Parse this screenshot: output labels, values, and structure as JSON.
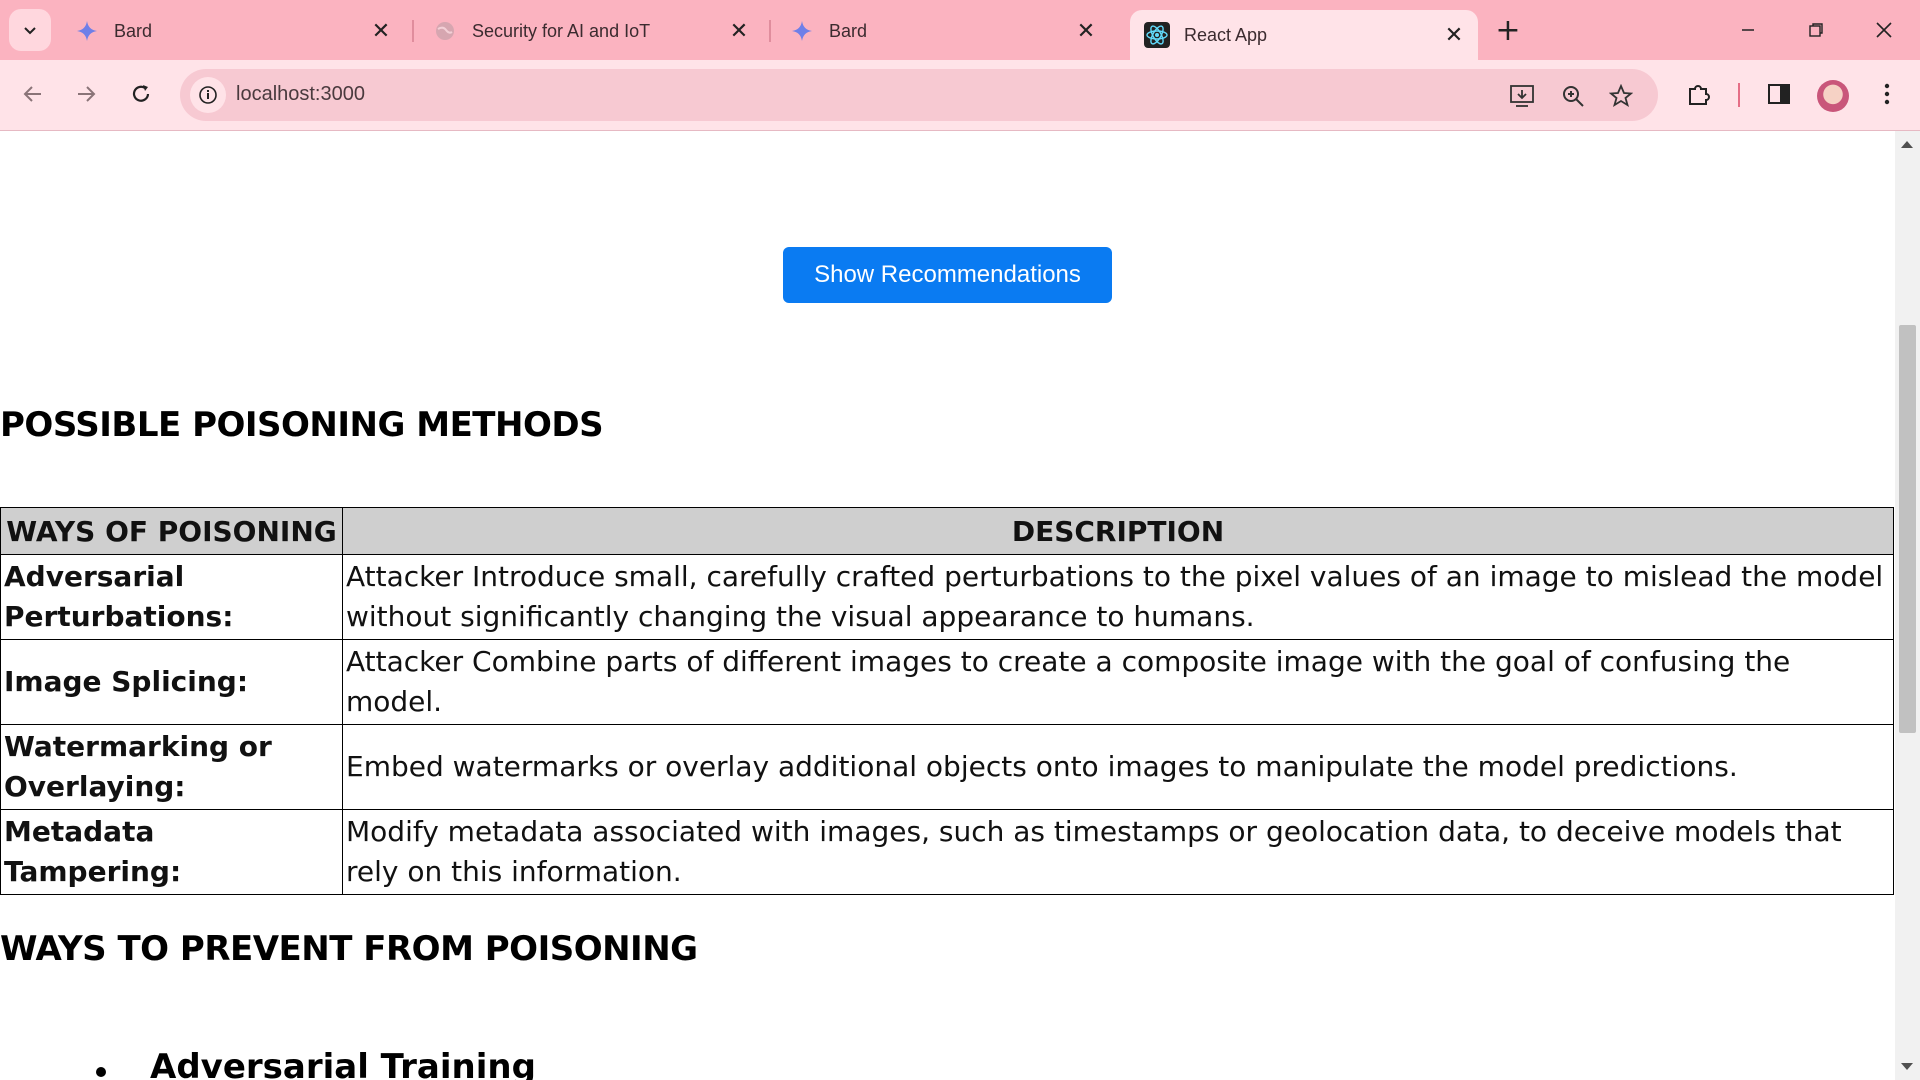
{
  "browser": {
    "tabs": [
      {
        "title": "Bard",
        "icon": "bard-sparkle-icon",
        "active": false
      },
      {
        "title": "Security for AI and IoT",
        "icon": "globe-icon",
        "active": false
      },
      {
        "title": "Bard",
        "icon": "bard-sparkle-icon",
        "active": false
      },
      {
        "title": "React App",
        "icon": "react-icon",
        "active": true
      }
    ],
    "url": "localhost:3000",
    "accent_color": "#fbb3c0"
  },
  "page": {
    "recommend_button": "Show Recommendations",
    "section1_title": "POSSIBLE POISONING METHODS",
    "table": {
      "headers": [
        "WAYS OF POISONING",
        "DESCRIPTION"
      ],
      "rows": [
        {
          "way": "Adversarial Perturbations:",
          "description": "Attacker Introduce small, carefully crafted perturbations to the pixel values of an image to mislead the model without significantly changing the visual appearance to humans."
        },
        {
          "way": "Image Splicing:",
          "description": "Attacker Combine parts of different images to create a composite image with the goal of confusing the model."
        },
        {
          "way": "Watermarking or Overlaying:",
          "description": "Embed watermarks or overlay additional objects onto images to manipulate the model predictions."
        },
        {
          "way": "Metadata Tampering:",
          "description": "Modify metadata associated with images, such as timestamps or geolocation data, to deceive models that rely on this information."
        }
      ]
    },
    "section2_title": "WAYS TO PREVENT FROM POISONING",
    "cut_item": "Adversarial Training"
  }
}
